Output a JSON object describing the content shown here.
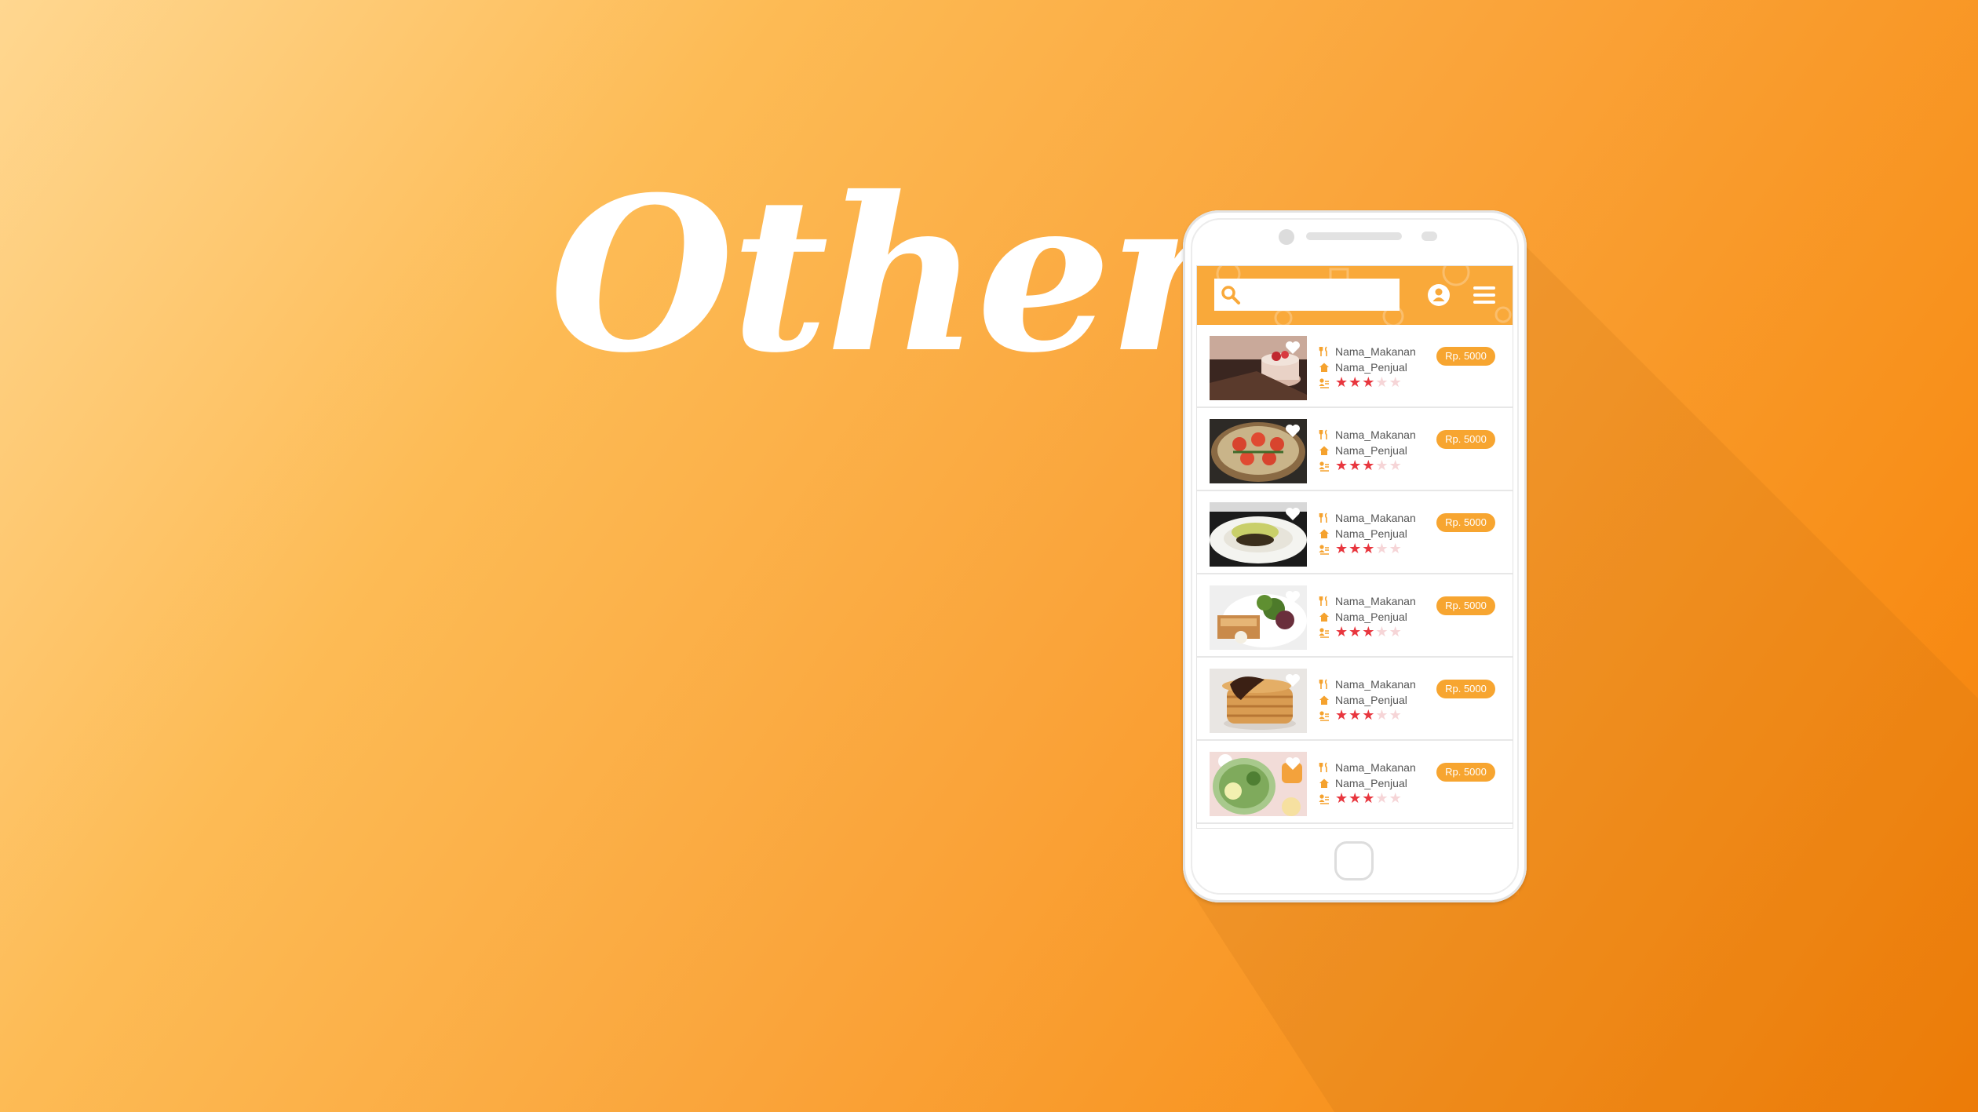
{
  "headline": "Other",
  "colors": {
    "accent": "#f9a93a",
    "price_badge": "#f7a530",
    "star_on": "#e8363e",
    "star_off": "#f6d5d7"
  },
  "app": {
    "search": {
      "placeholder": "",
      "value": ""
    },
    "icons": {
      "search": "search-icon",
      "user": "user-icon",
      "menu": "hamburger-menu-icon"
    },
    "items": [
      {
        "name": "Nama_Makanan",
        "seller": "Nama_Penjual",
        "price": "Rp. 5000",
        "rating": 3,
        "max_rating": 5,
        "image": "cake"
      },
      {
        "name": "Nama_Makanan",
        "seller": "Nama_Penjual",
        "price": "Rp. 5000",
        "rating": 3,
        "max_rating": 5,
        "image": "pizza"
      },
      {
        "name": "Nama_Makanan",
        "seller": "Nama_Penjual",
        "price": "Rp. 5000",
        "rating": 3,
        "max_rating": 5,
        "image": "omelette"
      },
      {
        "name": "Nama_Makanan",
        "seller": "Nama_Penjual",
        "price": "Rp. 5000",
        "rating": 3,
        "max_rating": 5,
        "image": "salad"
      },
      {
        "name": "Nama_Makanan",
        "seller": "Nama_Penjual",
        "price": "Rp. 5000",
        "rating": 3,
        "max_rating": 5,
        "image": "pancakes"
      },
      {
        "name": "Nama_Makanan",
        "seller": "Nama_Penjual",
        "price": "Rp. 5000",
        "rating": 3,
        "max_rating": 5,
        "image": "drink"
      }
    ]
  }
}
